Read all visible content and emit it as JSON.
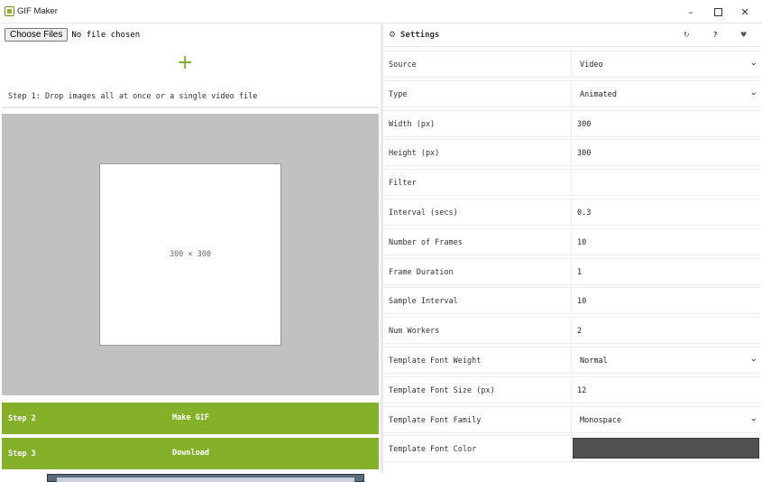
{
  "window": {
    "title": "GIF Maker",
    "minimize": "–",
    "close": "✕"
  },
  "left_pane": {
    "choose_files": "Choose Files",
    "no_file": "No file chosen",
    "plus": "+",
    "step1": "Step 1: Drop images all at once or a single video file",
    "preview_size": "300 × 300",
    "step2": {
      "label": "Step 2",
      "action": "Make GIF"
    },
    "step3": {
      "label": "Step 3",
      "action": "Download"
    }
  },
  "settings": {
    "title": "Settings",
    "icons": {
      "gear": "⚙",
      "reset": "↻",
      "help": "?",
      "heart": "♥"
    },
    "rows": [
      {
        "label": "Source",
        "value": "Video",
        "kind": "select"
      },
      {
        "label": "Type",
        "value": "Animated",
        "kind": "select"
      },
      {
        "label": "Width (px)",
        "value": "300",
        "kind": "input"
      },
      {
        "label": "Height (px)",
        "value": "300",
        "kind": "input"
      },
      {
        "label": "Filter",
        "value": "",
        "kind": "input"
      },
      {
        "label": "Interval (secs)",
        "value": "0.3",
        "kind": "input"
      },
      {
        "label": "Number of Frames",
        "value": "10",
        "kind": "input"
      },
      {
        "label": "Frame Duration",
        "value": "1",
        "kind": "input"
      },
      {
        "label": "Sample Interval",
        "value": "10",
        "kind": "input"
      },
      {
        "label": "Num Workers",
        "value": "2",
        "kind": "input"
      },
      {
        "label": "Template Font Weight",
        "value": "Normal",
        "kind": "select"
      },
      {
        "label": "Template Font Size (px)",
        "value": "12",
        "kind": "input"
      },
      {
        "label": "Template Font Family",
        "value": "Monospace",
        "kind": "select"
      },
      {
        "label": "Template Font Color",
        "value": "",
        "kind": "color",
        "color": "#505050"
      }
    ]
  },
  "colors": {
    "accent_green": "#85b02a",
    "preview_gray": "#c1c1c1"
  }
}
